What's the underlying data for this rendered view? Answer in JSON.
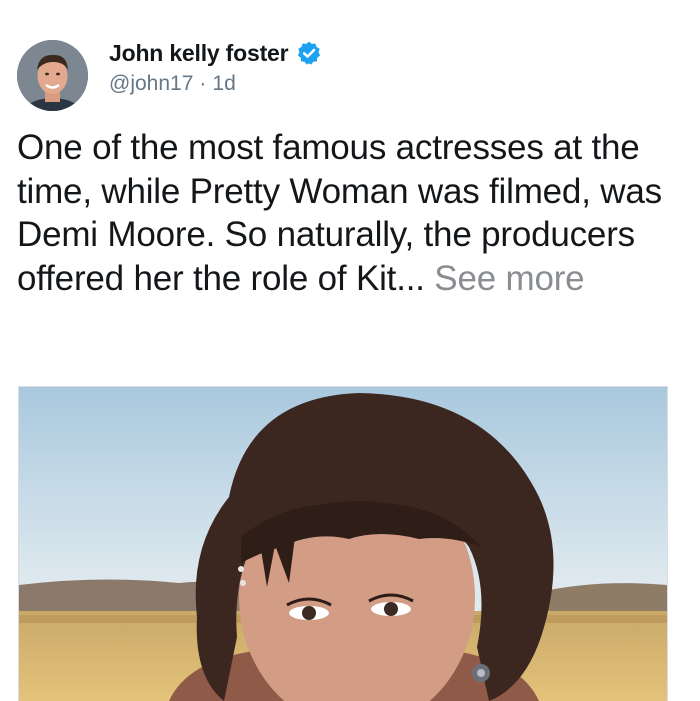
{
  "tweet": {
    "author": {
      "display_name": "John kelly foster",
      "handle": "@john17",
      "verified": true,
      "avatar_icon": "profile-photo"
    },
    "separator": "·",
    "timestamp": "1d",
    "text": "One of the most famous actresses at the time, while Pretty Woman was filmed, was Demi Moore. So naturally, the producers offered her the role of Kit...",
    "see_more_label": "See more",
    "media": {
      "type": "photo"
    }
  },
  "colors": {
    "verified_blue": "#1da1f2",
    "secondary_text": "#657786",
    "see_more_text": "#8a8d91"
  }
}
